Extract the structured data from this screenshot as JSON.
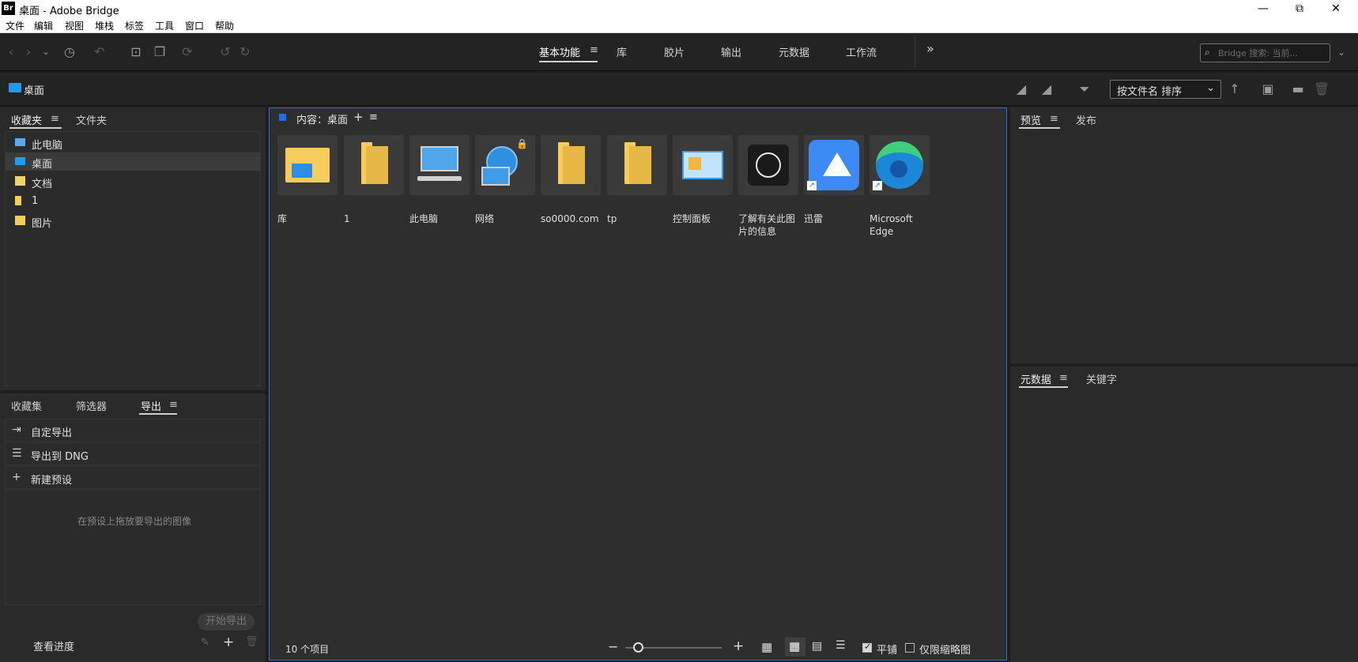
{
  "window": {
    "logo": "Br",
    "title": "桌面 - Adobe Bridge",
    "minimize": "—",
    "restore": "⧉",
    "close": "✕"
  },
  "menu": [
    "文件",
    "编辑",
    "视图",
    "堆栈",
    "标签",
    "工具",
    "窗口",
    "帮助"
  ],
  "workspaces": {
    "items": [
      "基本功能",
      "库",
      "胶片",
      "输出",
      "元数据",
      "工作流"
    ],
    "active": "基本功能",
    "more": "»"
  },
  "search": {
    "placeholder": "Bridge 搜索: 当前..."
  },
  "path": {
    "label": "桌面"
  },
  "sort": {
    "label": "按文件名 排序"
  },
  "left_top": {
    "tabs": [
      "收藏夹",
      "文件夹"
    ],
    "items": [
      {
        "label": "此电脑",
        "icon": "computer-icon",
        "color": "#5aa8e8"
      },
      {
        "label": "桌面",
        "icon": "desktop-icon",
        "color": "#1f9bf0"
      },
      {
        "label": "文档",
        "icon": "document-icon",
        "color": "#f2d16b"
      },
      {
        "label": "1",
        "icon": "folder-icon",
        "color": "#f6cc5d"
      },
      {
        "label": "图片",
        "icon": "pictures-icon",
        "color": "#f6cc5d"
      }
    ]
  },
  "left_bottom": {
    "tabs": [
      "收藏集",
      "筛选器",
      "导出"
    ],
    "rows": [
      {
        "label": "自定导出",
        "icon": "export-icon",
        "glyph": "⇥"
      },
      {
        "label": "导出到 DNG",
        "icon": "list-icon",
        "glyph": "☰"
      },
      {
        "label": "新建预设",
        "icon": "plus-icon",
        "glyph": "+"
      }
    ],
    "hint": "在预设上拖放要导出的图像",
    "start_export": "开始导出",
    "view_progress": "查看进度"
  },
  "content": {
    "header": "内容：桌面",
    "items": [
      {
        "label": "库",
        "type": "library"
      },
      {
        "label": "1",
        "type": "folder"
      },
      {
        "label": "此电脑",
        "type": "computer"
      },
      {
        "label": "网络",
        "type": "network"
      },
      {
        "label": "so0000.com",
        "type": "folder"
      },
      {
        "label": "tp",
        "type": "folder"
      },
      {
        "label": "控制面板",
        "type": "control-panel"
      },
      {
        "label": "了解有关此图片的信息",
        "type": "info"
      },
      {
        "label": "迅雷",
        "type": "xunlei"
      },
      {
        "label": "Microsoft Edge",
        "type": "edge"
      }
    ],
    "count": "10 个项目",
    "tile_label": "平铺",
    "thumb_only_label": "仅限缩略图"
  },
  "right_top": {
    "tabs": [
      "预览",
      "发布"
    ]
  },
  "right_bottom": {
    "tabs": [
      "元数据",
      "关键字"
    ]
  },
  "colors": {
    "accent": "#2f6ed2",
    "folder": "#f6cc5d"
  }
}
